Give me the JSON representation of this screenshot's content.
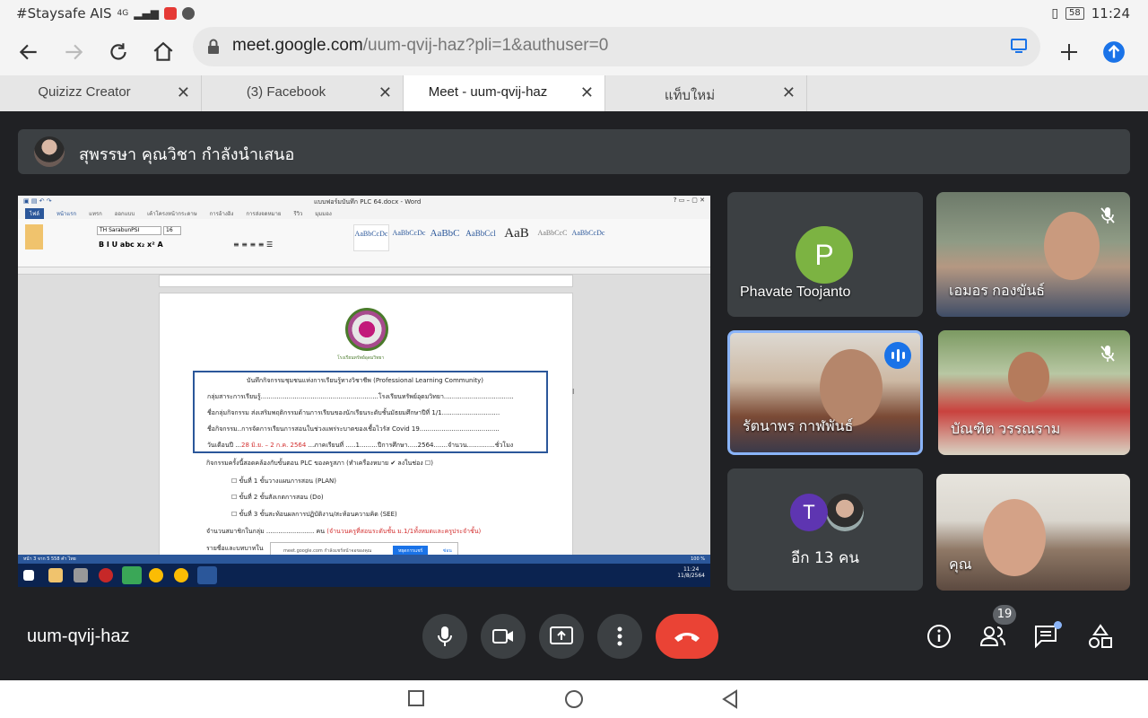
{
  "status": {
    "carrier": "#Staysafe AIS",
    "network": "4G",
    "battery": "58",
    "time": "11:24"
  },
  "browser": {
    "url_host": "meet.google.com",
    "url_path": "/uum-qvij-haz?pli=1&authuser=0",
    "tabs": [
      {
        "label": "Quizizz Creator",
        "active": false
      },
      {
        "label": "(3) Facebook",
        "active": false
      },
      {
        "label": "Meet - uum-qvij-haz",
        "active": true
      },
      {
        "label": "แท็บใหม่",
        "active": false
      }
    ]
  },
  "presenting": {
    "text": "สุพรรษา คุณวิชา กำลังนำเสนอ"
  },
  "word_doc": {
    "window_title": "แบบฟอร์มบันทึก PLC 64.docx - Word",
    "menu": [
      "ไฟล์",
      "หน้าแรก",
      "แทรก",
      "ออกแบบ",
      "เค้าโครงหน้ากระดาษ",
      "การอ้างอิง",
      "การส่งจดหมาย",
      "รีวิว",
      "มุมมอง"
    ],
    "font_name": "TH SarabunPSI",
    "font_size": "16",
    "styles": [
      "AaBbCcDc",
      "AaBbCcDc",
      "AaBbC",
      "AaBbCcl",
      "AaB",
      "AaBbCcC",
      "AaBbCcDc"
    ],
    "logo_caption": "โรงเรียนทรัพย์อุดมวิทยา",
    "memo": {
      "title": "บันทึกกิจกรรมชุมชนแห่งการเรียนรู้ทางวิชาชีพ (Professional Learning Community)",
      "line1": "กลุ่มสาระการเรียนรู้...........................................................โรงเรียนทรัพย์อุดมวิทยา...................................",
      "line2": "ชื่อกลุ่มกิจกรรม ส่งเสริมพฤติกรรมด้านการเรียนของนักเรียนระดับชั้นมัธยมศึกษาปีที่ 1/1.............................",
      "line3": "ชื่อกิจกรรม..การจัดการเรียนการสอนในช่วงแพร่ระบาดของเชื้อไวรัส Covid 19........................................",
      "line4_prefix": "วันเดือนปี ...",
      "line4_red": "28 มิ.ย. – 2 ก.ค. 2564",
      "line4_rest": " ...ภาคเรียนที่ .....1.........ปีการศึกษา.....2564.......จำนวน..............ชั่วโมง"
    },
    "activity_intro": "กิจกรรมครั้งนี้สอดคล้องกับขั้นตอน PLC ของครูสภา (ทำเครื่องหมาย ✔ ลงในช่อง ☐)",
    "steps": [
      "☐  ขั้นที่ 1 ขั้นวางแผนการสอน (PLAN)",
      "☐  ขั้นที่ 2 ขั้นสังเกตการสอน (Do)",
      "☐  ขั้นที่ 3 ขั้นสะท้อนผลการปฏิบัติงาน/สะท้อนความคิด (SEE)"
    ],
    "members_line": "จำนวนสมาชิกในกลุ่ม ........................ คน",
    "members_red": "(จำนวนครูที่สอนระดับชั้น ม.1/1ทั้งหมดและครูประจำชั้น)",
    "names_line": "รายชื่อและบทบาทใน",
    "toast_text": "meet.google.com กำลังแชร์หน้าจอของคุณ",
    "toast_button": "หยุดการแชร์",
    "toast_hide": "ซ่อน",
    "statusbar_text": "หน้า 3 จาก 5    558 คำ    ไทย",
    "zoom": "100 %",
    "clock_time": "11:24",
    "clock_date": "11/8/2564"
  },
  "participants": [
    {
      "name": "Phavate Toojanto",
      "initial": "P",
      "color": "#7cb342",
      "muted": false
    },
    {
      "name": "เอมอร กองขันธ์",
      "muted": true
    },
    {
      "name": "รัตนาพร กาฬพันธ์",
      "speaking": true
    },
    {
      "name": "บัณฑิต วรรณราม",
      "muted": true
    },
    {
      "name": "คุณ"
    }
  ],
  "others": {
    "initial": "T",
    "initial_color": "#5e35b1",
    "label": "อีก 13 คน"
  },
  "controls": {
    "meeting_code": "uum-qvij-haz",
    "people_count": "19"
  }
}
